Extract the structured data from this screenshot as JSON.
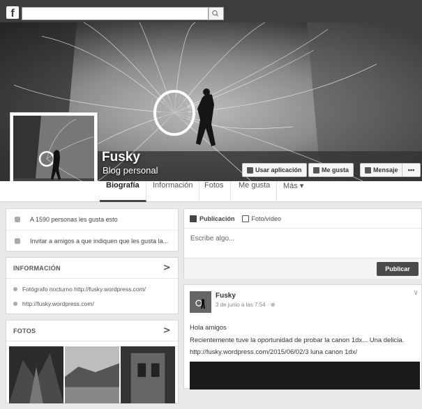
{
  "topbar": {
    "search_placeholder": ""
  },
  "page": {
    "name": "Fusky",
    "category": "Blog personal"
  },
  "cover_buttons": {
    "use_app": "Usar aplicación",
    "like": "Me gusta",
    "message": "Mensaje",
    "more": "•••"
  },
  "tabs": [
    "Biografía",
    "Información",
    "Fotos",
    "Me gusta",
    "Más ▾"
  ],
  "left": {
    "likes_text": "A 1590 personas les gusta esto",
    "invite_text": "Invitar a amigos a que indiquen que les gusta la...",
    "info_header": "INFORMACIÓN",
    "info_items": [
      "Fotógrafo nocturno http://fusky.wordpress.com/",
      "http://fusky.wordpress.com/"
    ],
    "photos_header": "FOTOS",
    "chevron": ">"
  },
  "composer": {
    "tab_post": "Publicación",
    "tab_photo": "Foto/vídeo",
    "placeholder": "Escribe algo...",
    "publish": "Publicar"
  },
  "post": {
    "author": "Fusky",
    "time": "3 de junio a las 7:54 · ⊕",
    "line1": "Hola amigos",
    "line2": "Recientemente tuve la oportunidad de probar la canon 1dx... Una delicia.",
    "line3": "http://fusky.wordpress.com/2015/06/02/3 luna canon 1dx/",
    "menu": "∨"
  },
  "colors": {
    "topbar": "#3d3d3d",
    "publish": "#4a4a4a"
  }
}
